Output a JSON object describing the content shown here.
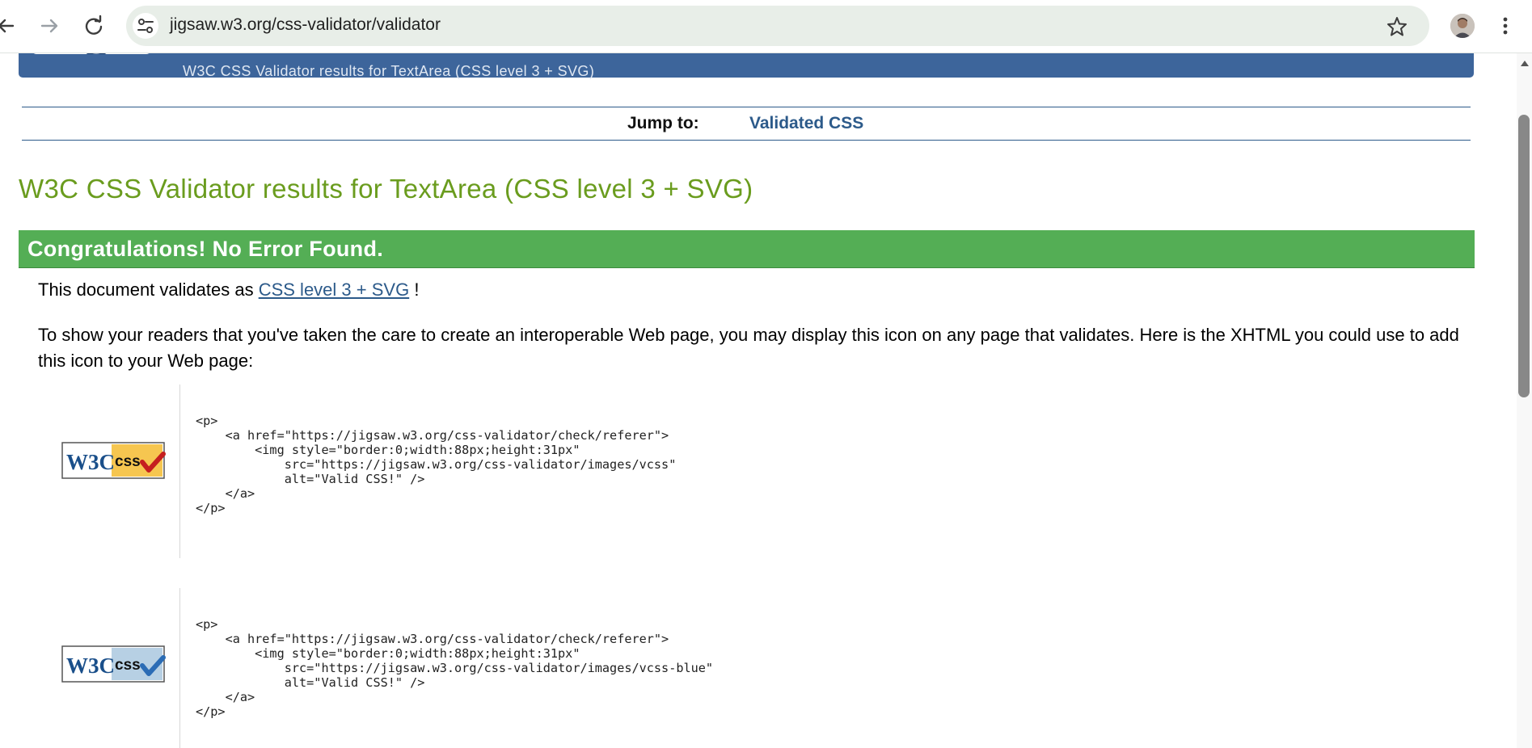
{
  "browser": {
    "url": "jigsaw.w3.org/css-validator/validator",
    "icons": [
      "back-arrow-icon",
      "forward-arrow-icon",
      "reload-icon",
      "site-info-icon",
      "bookmark-star-icon",
      "profile-avatar",
      "more-menu-icon"
    ]
  },
  "banner": {
    "subtitle": "W3C CSS Validator results for TextArea (CSS level 3 + SVG)"
  },
  "jump": {
    "label": "Jump to:",
    "link": "Validated CSS"
  },
  "results": {
    "title": "W3C CSS Validator results for TextArea (CSS level 3 + SVG)",
    "success": "Congratulations! No Error Found.",
    "validates_prefix": "This document validates as",
    "validates_link": "CSS level 3 + SVG",
    "validates_suffix": "!",
    "info": "To show your readers that you've taken the care to create an interoperable Web page, you may display this icon on any page that validates. Here is the XHTML you could use to add this icon to your Web page:"
  },
  "snippets": [
    {
      "badge": "W3C CSS",
      "badge_color": "#f6c650",
      "check_color": "#c51f1f",
      "code": "<p>\n    <a href=\"https://jigsaw.w3.org/css-validator/check/referer\">\n        <img style=\"border:0;width:88px;height:31px\"\n            src=\"https://jigsaw.w3.org/css-validator/images/vcss\"\n            alt=\"Valid CSS!\" />\n    </a>\n</p>"
    },
    {
      "badge": "W3C CSS",
      "badge_color": "#b7d0e4",
      "check_color": "#2b6cb5",
      "code": "<p>\n    <a href=\"https://jigsaw.w3.org/css-validator/check/referer\">\n        <img style=\"border:0;width:88px;height:31px\"\n            src=\"https://jigsaw.w3.org/css-validator/images/vcss-blue\"\n            alt=\"Valid CSS!\" />\n    </a>\n</p>"
    }
  ],
  "colors": {
    "banner": "#3d659b",
    "title_green": "#6a9c1e",
    "success_green": "#54ae55",
    "link_blue": "#2c5a8a"
  }
}
